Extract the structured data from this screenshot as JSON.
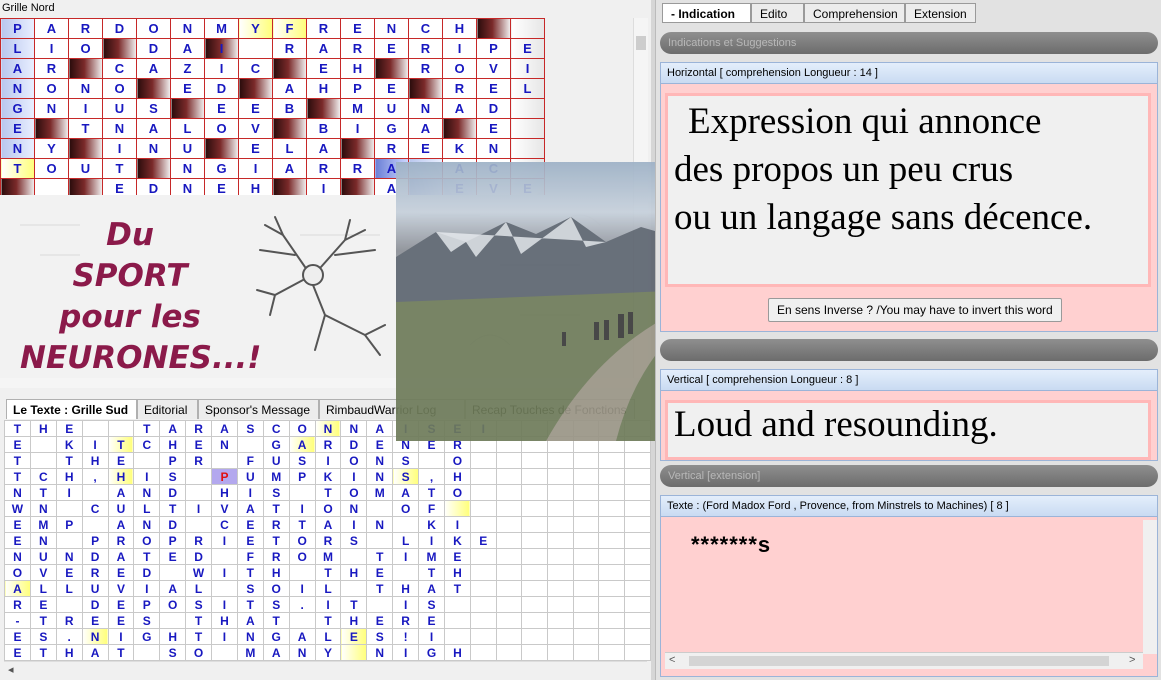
{
  "north": {
    "title": "Grille Nord",
    "rows": [
      [
        "P",
        "A",
        "R",
        "D",
        "O",
        "N",
        "M",
        "Y",
        "F",
        "R",
        "E",
        "N",
        "C",
        "H",
        "",
        "",
        ""
      ],
      [
        "L",
        "I",
        "O",
        "",
        "D",
        "A",
        "I",
        "",
        "R",
        "A",
        "R",
        "E",
        "R",
        "I",
        "P",
        "E",
        ""
      ],
      [
        "A",
        "R",
        "",
        "C",
        "A",
        "Z",
        "I",
        "C",
        "",
        "E",
        "H",
        "",
        "R",
        "O",
        "V",
        "I",
        ""
      ],
      [
        "N",
        "O",
        "N",
        "O",
        "",
        "E",
        "D",
        "",
        "A",
        "H",
        "P",
        "E",
        "",
        "R",
        "E",
        "L",
        ""
      ],
      [
        "G",
        "N",
        "I",
        "U",
        "S",
        "",
        "E",
        "E",
        "B",
        "",
        "M",
        "U",
        "N",
        "A",
        "D",
        "",
        ""
      ],
      [
        "E",
        "",
        "T",
        "N",
        "A",
        "L",
        "O",
        "V",
        "",
        "B",
        "I",
        "G",
        "A",
        "",
        "E",
        "",
        ""
      ],
      [
        "N",
        "Y",
        "",
        "I",
        "N",
        "U",
        "",
        "E",
        "L",
        "A",
        "",
        "R",
        "E",
        "K",
        "N",
        "",
        ""
      ],
      [
        "T",
        "O",
        "U",
        "T",
        "",
        "N",
        "G",
        "I",
        "A",
        "R",
        "R",
        "A",
        "",
        "A",
        "C",
        "",
        ""
      ],
      [
        "",
        "",
        "",
        "E",
        "D",
        "N",
        "E",
        "H",
        "",
        "I",
        "",
        "A",
        "",
        "E",
        "V",
        "E",
        ""
      ]
    ],
    "shades": [
      "bwwwwwwyywwwwwkn",
      "bwwkwwkwwwwwwwwn",
      "bwkwwwwwkwwkwwwn",
      "bwwwkwwkwwwwkwwn",
      "bwwwwkwwwkwwwwwn",
      "bkwwwwwwkwwwwkwn",
      "bwkwwwkwwwkwwwwn",
      "ywwwkwwwwwwpbwwn",
      "kwkwwwwwkwkwpbwn"
    ]
  },
  "slogan": {
    "l1": "Du",
    "l2": "SPORT",
    "l3": "pour les",
    "l4": "NEURONES...!"
  },
  "south": {
    "tabs": [
      "Le Texte : Grille Sud",
      "Editorial",
      "Sponsor's Message",
      "RimbaudWarrior Log",
      "Recap Touches de Fonctions"
    ],
    "rows": [
      [
        "T",
        "H",
        "E",
        "",
        "",
        "T",
        "A",
        "R",
        "A",
        "S",
        "C",
        "O",
        "N",
        "N",
        "A",
        "I",
        "S",
        "E",
        "I",
        "",
        ""
      ],
      [
        "E",
        "",
        "K",
        "I",
        "T",
        "C",
        "H",
        "E",
        "N",
        "",
        "G",
        "A",
        "R",
        "D",
        "E",
        "N",
        "E",
        "R",
        "",
        ""
      ],
      [
        "T",
        "",
        "T",
        "H",
        "E",
        "",
        "P",
        "R",
        "",
        "F",
        "U",
        "S",
        "I",
        "O",
        "N",
        "S",
        "",
        "O",
        ""
      ],
      [
        "T",
        "C",
        "H",
        ",",
        "H",
        "I",
        "S",
        "",
        "P",
        "U",
        "M",
        "P",
        "K",
        "I",
        "N",
        "S",
        ",",
        "H",
        ""
      ],
      [
        "N",
        "T",
        "I",
        "",
        "A",
        "N",
        "D",
        "",
        "H",
        "I",
        "S",
        "",
        "T",
        "O",
        "M",
        "A",
        "T",
        "O",
        ""
      ],
      [
        "W",
        "N",
        "",
        "C",
        "U",
        "L",
        "T",
        "I",
        "V",
        "A",
        "T",
        "I",
        "O",
        "N",
        "",
        "O",
        "F",
        ""
      ],
      [
        "E",
        "M",
        "P",
        "",
        "A",
        "N",
        "D",
        "",
        "C",
        "E",
        "R",
        "T",
        "A",
        "I",
        "N",
        "",
        "K",
        "I",
        ""
      ],
      [
        "E",
        "N",
        "",
        "P",
        "R",
        "O",
        "P",
        "R",
        "I",
        "E",
        "T",
        "O",
        "R",
        "S",
        "",
        "L",
        "I",
        "K",
        "E"
      ],
      [
        "N",
        "U",
        "N",
        "D",
        "A",
        "T",
        "E",
        "D",
        "",
        "F",
        "R",
        "O",
        "M",
        "",
        "T",
        "I",
        "M",
        "E",
        ""
      ],
      [
        "O",
        "V",
        "E",
        "R",
        "E",
        "D",
        "",
        "W",
        "I",
        "T",
        "H",
        "",
        "T",
        "H",
        "E",
        "",
        "T",
        "H",
        ""
      ],
      [
        "A",
        "L",
        "L",
        "U",
        "V",
        "I",
        "A",
        "L",
        "",
        "S",
        "O",
        "I",
        "L",
        "",
        "T",
        "H",
        "A",
        "T",
        ""
      ],
      [
        "R",
        "E",
        "",
        "D",
        "E",
        "P",
        "O",
        "S",
        "I",
        "T",
        "S",
        ".",
        "I",
        "T",
        "",
        "I",
        "S",
        ""
      ],
      [
        "-",
        "T",
        "R",
        "E",
        "E",
        "S",
        "",
        "T",
        "H",
        "A",
        "T",
        "",
        "T",
        "H",
        "E",
        "R",
        "E",
        ""
      ],
      [
        "E",
        "S",
        ".",
        "N",
        "I",
        "G",
        "H",
        "T",
        "I",
        "N",
        "G",
        "A",
        "L",
        "E",
        "S",
        "!",
        "I",
        ""
      ],
      [
        "E",
        "T",
        "H",
        "A",
        "T",
        "",
        "S",
        "O",
        "",
        "M",
        "A",
        "N",
        "Y",
        "",
        "N",
        "I",
        "G",
        "H",
        ""
      ]
    ]
  },
  "right": {
    "tabs": [
      "- Indication -",
      "Edito",
      "Comprehension",
      "Extension"
    ],
    "bar_indications": "Indications et Suggestions",
    "horizontal": {
      "header": "Horizontal [ comprehension   Longueur : 14 ]",
      "line1": "Expression qui annonce",
      "line2": "des propos un peu crus",
      "line3": "ou un langage sans décence.",
      "inverse": "En sens Inverse ? /You may have to invert this word"
    },
    "vertical": {
      "header": "Vertical [ comprehension   Longueur : 8 ]",
      "text": "Loud and resounding."
    },
    "bar_vertical_ext": "Vertical [extension]",
    "texte": {
      "header": "Texte :  (Ford Madox Ford , Provence, from Minstrels to Machines)  [ 8 ]",
      "answer": "*******s"
    }
  }
}
